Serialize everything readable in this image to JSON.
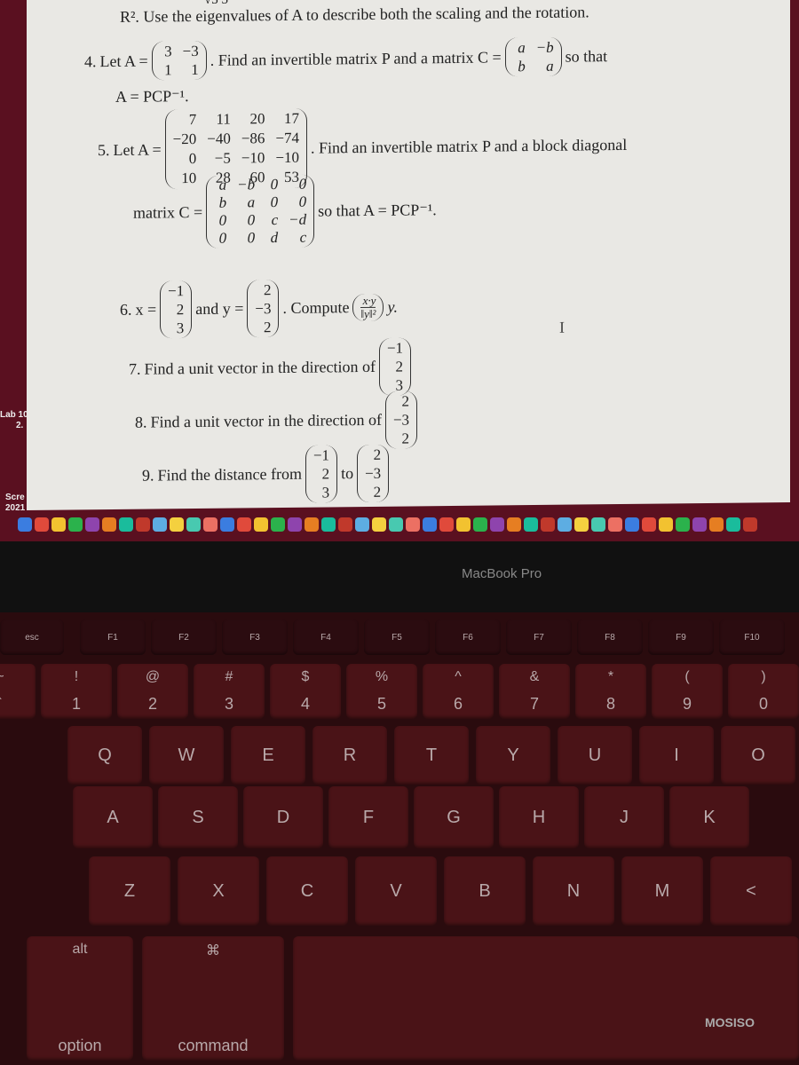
{
  "document": {
    "top_fragment": "√3   3",
    "intro": "R². Use the eigenvalues of A to describe both the scaling and the rotation.",
    "q4": {
      "num": "4.",
      "lead": "Let A =",
      "matrix": [
        [
          "3",
          "−3"
        ],
        [
          "1",
          "1"
        ]
      ],
      "text": ". Find an invertible matrix P and a matrix C =",
      "cmatrix": [
        [
          "a",
          "−b"
        ],
        [
          "b",
          "a"
        ]
      ],
      "tail": "so that",
      "line2": "A = PCP⁻¹."
    },
    "q5": {
      "num": "5.",
      "lead": "Let A =",
      "matrix": [
        [
          "7",
          "11",
          "20",
          "17"
        ],
        [
          "−20",
          "−40",
          "−86",
          "−74"
        ],
        [
          "0",
          "−5",
          "−10",
          "−10"
        ],
        [
          "10",
          "28",
          "60",
          "53"
        ]
      ],
      "text": ". Find an invertible matrix P and a block diagonal",
      "lead2": "matrix C =",
      "cmatrix": [
        [
          "a",
          "−b",
          "0",
          "0"
        ],
        [
          "b",
          "a",
          "0",
          "0"
        ],
        [
          "0",
          "0",
          "c",
          "−d"
        ],
        [
          "0",
          "0",
          "d",
          "c"
        ]
      ],
      "tail": "so that A = PCP⁻¹."
    },
    "q6": {
      "num": "6.",
      "x_label": "x =",
      "x": [
        "−1",
        "2",
        "3"
      ],
      "and": "and y =",
      "y": [
        "2",
        "−3",
        "2"
      ],
      "text": ". Compute",
      "frac_num": "x·y",
      "frac_den": "‖y‖²",
      "tail": "y."
    },
    "q7": {
      "num": "7.",
      "text": "Find a unit vector in the direction of",
      "v": [
        "−1",
        "2",
        "3"
      ]
    },
    "q8": {
      "num": "8.",
      "text": "Find a unit vector in the direction of",
      "v": [
        "2",
        "−3",
        "2"
      ]
    },
    "q9": {
      "num": "9.",
      "text": "Find the distance from",
      "v1": [
        "−1",
        "2",
        "3"
      ],
      "to": "to",
      "v2": [
        "2",
        "−3",
        "2"
      ]
    }
  },
  "desktop": {
    "labels": [
      "Lab 10",
      "2.",
      "Scre",
      "2021"
    ]
  },
  "bezel": {
    "brand": "MacBook Pro"
  },
  "keyboard": {
    "fn_row": [
      "esc",
      "F1",
      "F2",
      "F3",
      "F4",
      "F5",
      "F6",
      "F7",
      "F8",
      "F9",
      "F10"
    ],
    "number_row": [
      [
        "~",
        "`"
      ],
      [
        "!",
        "1"
      ],
      [
        "@",
        "2"
      ],
      [
        "#",
        "3"
      ],
      [
        "$",
        "4"
      ],
      [
        "%",
        "5"
      ],
      [
        "^",
        "6"
      ],
      [
        "&",
        "7"
      ],
      [
        "*",
        "8"
      ],
      [
        "(",
        "9"
      ],
      [
        ")",
        "0"
      ]
    ],
    "row_q": [
      "Q",
      "W",
      "E",
      "R",
      "T",
      "Y",
      "U",
      "I",
      "O"
    ],
    "row_a": [
      "A",
      "S",
      "D",
      "F",
      "G",
      "H",
      "J",
      "K"
    ],
    "row_z": [
      "Z",
      "X",
      "C",
      "V",
      "B",
      "N",
      "M",
      "<"
    ],
    "bottom": {
      "alt": "alt",
      "option": "option",
      "cmd_symbol": "⌘",
      "command": "command"
    },
    "brand_sticker": "MOSISO"
  },
  "colors": {
    "desktop": "#5a1020",
    "page": "#e9e8e4",
    "key": "#4a1317"
  }
}
